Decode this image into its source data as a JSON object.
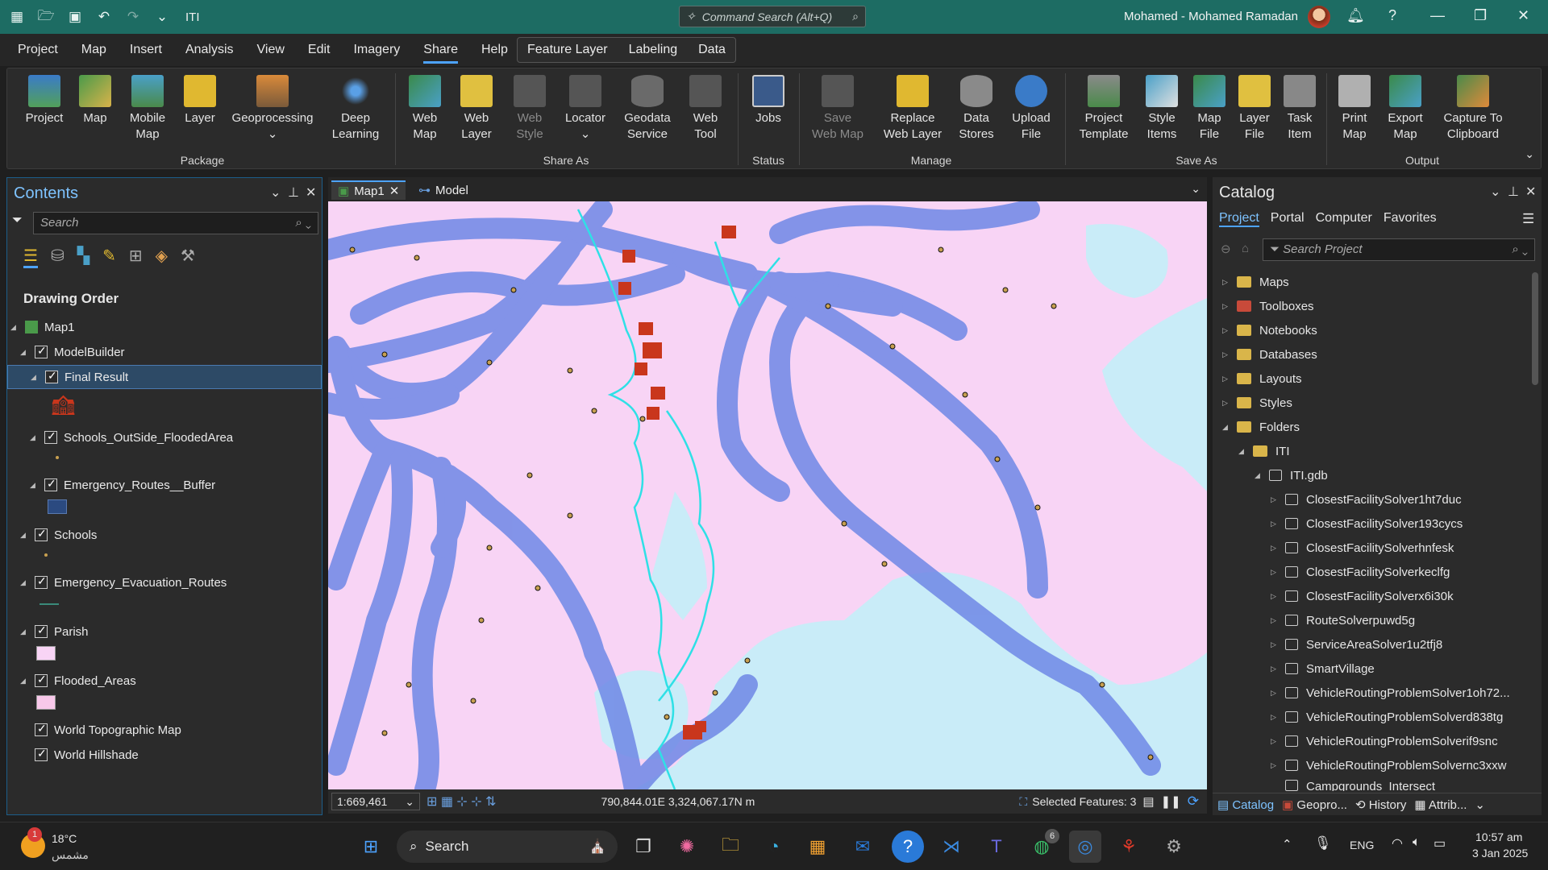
{
  "titlebar": {
    "project": "ITI",
    "command_search_placeholder": "Command Search (Alt+Q)",
    "user": "Mohamed  -  Mohamed Ramadan"
  },
  "menu": {
    "items": [
      "Project",
      "Map",
      "Insert",
      "Analysis",
      "View",
      "Edit",
      "Imagery",
      "Share",
      "Help"
    ],
    "active": "Share",
    "contextual": [
      "Feature Layer",
      "Labeling",
      "Data"
    ]
  },
  "ribbon": {
    "project": "Project",
    "map": "Map",
    "mobile_map": "Mobile\nMap",
    "layer": "Layer",
    "geoprocessing": "Geoprocessing",
    "deep_learning": "Deep\nLearning",
    "web_map": "Web\nMap",
    "web_layer": "Web\nLayer",
    "web_style": "Web\nStyle",
    "locator": "Locator",
    "geodata_service": "Geodata\nService",
    "web_tool": "Web\nTool",
    "jobs": "Jobs",
    "save_web_map": "Save\nWeb Map",
    "replace_web_layer": "Replace\nWeb Layer",
    "data_stores": "Data\nStores",
    "upload_file": "Upload\nFile",
    "project_template": "Project\nTemplate",
    "style_items": "Style\nItems",
    "map_file": "Map\nFile",
    "layer_file": "Layer\nFile",
    "task_item": "Task\nItem",
    "print_map": "Print\nMap",
    "export_map": "Export\nMap",
    "capture_clipboard": "Capture To\nClipboard",
    "groups": {
      "package": "Package",
      "share_as": "Share As",
      "status": "Status",
      "manage": "Manage",
      "save_as": "Save As",
      "output": "Output"
    }
  },
  "contents": {
    "title": "Contents",
    "search_placeholder": "Search",
    "drawing_order": "Drawing Order",
    "map": "Map1",
    "layers": [
      "ModelBuilder",
      "Final Result",
      "Schools_OutSide_FloodedArea",
      "Emergency_Routes__Buffer",
      "Schools",
      "Emergency_Evacuation_Routes",
      "Parish",
      "Flooded_Areas",
      "World Topographic Map",
      "World Hillshade"
    ]
  },
  "map": {
    "tabs": [
      "Map1",
      "Model"
    ],
    "scale": "1:669,461",
    "coords": "790,844.01E 3,324,067.17N m",
    "selected": "Selected Features: 3",
    "colors": {
      "water": "#c9ecf8",
      "land": "#f8d4f5",
      "buffer": "#6f88e6",
      "boundary": "#2fe0e6",
      "school": "#c9361c"
    }
  },
  "catalog": {
    "title": "Catalog",
    "tabs": [
      "Project",
      "Portal",
      "Computer",
      "Favorites"
    ],
    "search_placeholder": "Search Project",
    "items": [
      "Maps",
      "Toolboxes",
      "Notebooks",
      "Databases",
      "Layouts",
      "Styles",
      "Folders"
    ],
    "folder": "ITI",
    "gdb": "ITI.gdb",
    "gdb_items": [
      "ClosestFacilitySolver1ht7duc",
      "ClosestFacilitySolver193cycs",
      "ClosestFacilitySolverhnfesk",
      "ClosestFacilitySolverkeclfg",
      "ClosestFacilitySolverx6i30k",
      "RouteSolverpuwd5g",
      "ServiceAreaSolver1u2tfj8",
      "SmartVillage",
      "VehicleRoutingProblemSolver1oh72...",
      "VehicleRoutingProblemSolverd838tg",
      "VehicleRoutingProblemSolverif9snc",
      "VehicleRoutingProblemSolvernc3xxw",
      "Campgrounds_Intersect"
    ],
    "bottom_tabs": [
      "Catalog",
      "Geopro...",
      "History",
      "Attrib..."
    ]
  },
  "taskbar": {
    "weather_temp": "18°C",
    "weather_desc": "مشمس",
    "search": "Search",
    "lang": "ENG",
    "time": "10:57 am",
    "date": "3 Jan 2025",
    "badge_weather": "1",
    "badge_whatsapp": "6"
  }
}
